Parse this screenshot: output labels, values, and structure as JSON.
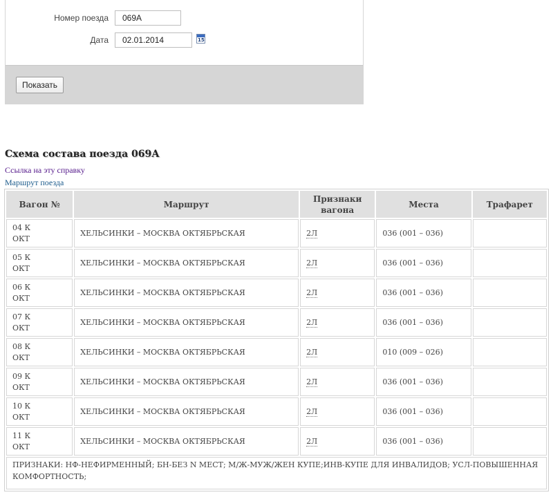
{
  "form": {
    "train_label": "Номер поезда",
    "train_value": "069А",
    "date_label": "Дата",
    "date_value": "02.01.2014",
    "calendar_digits": "15",
    "show_button": "Показать"
  },
  "schedule": {
    "title": "Схема состава поезда 069А",
    "link_reference": "Ссылка на эту справку",
    "link_route": "Маршрут поезда"
  },
  "table": {
    "headers": [
      "Вагон №",
      "Маршрут",
      "Признаки вагона",
      "Места",
      "Трафарет"
    ],
    "rows": [
      {
        "car": "04 К",
        "cat": "ОКТ",
        "route": "ХЕЛЬСИНКИ – МОСКВА ОКТЯБРЬСКАЯ",
        "sign": "2Л",
        "seats": "036 (001 – 036)",
        "stencil": ""
      },
      {
        "car": "05 К",
        "cat": "ОКТ",
        "route": "ХЕЛЬСИНКИ – МОСКВА ОКТЯБРЬСКАЯ",
        "sign": "2Л",
        "seats": "036 (001 – 036)",
        "stencil": ""
      },
      {
        "car": "06 К",
        "cat": "ОКТ",
        "route": "ХЕЛЬСИНКИ – МОСКВА ОКТЯБРЬСКАЯ",
        "sign": "2Л",
        "seats": "036 (001 – 036)",
        "stencil": ""
      },
      {
        "car": "07 К",
        "cat": "ОКТ",
        "route": "ХЕЛЬСИНКИ – МОСКВА ОКТЯБРЬСКАЯ",
        "sign": "2Л",
        "seats": "036 (001 – 036)",
        "stencil": ""
      },
      {
        "car": "08 К",
        "cat": "ОКТ",
        "route": "ХЕЛЬСИНКИ – МОСКВА ОКТЯБРЬСКАЯ",
        "sign": "2Л",
        "seats": "010 (009 – 026)",
        "stencil": ""
      },
      {
        "car": "09 К",
        "cat": "ОКТ",
        "route": "ХЕЛЬСИНКИ – МОСКВА ОКТЯБРЬСКАЯ",
        "sign": "2Л",
        "seats": "036 (001 – 036)",
        "stencil": ""
      },
      {
        "car": "10 К",
        "cat": "ОКТ",
        "route": "ХЕЛЬСИНКИ – МОСКВА ОКТЯБРЬСКАЯ",
        "sign": "2Л",
        "seats": "036 (001 – 036)",
        "stencil": ""
      },
      {
        "car": "11 К",
        "cat": "ОКТ",
        "route": "ХЕЛЬСИНКИ – МОСКВА ОКТЯБРЬСКАЯ",
        "sign": "2Л",
        "seats": "036 (001 – 036)",
        "stencil": ""
      }
    ],
    "footnote": "ПРИЗНАКИ: НФ-НЕФИРМЕННЫЙ; БН-БЕЗ N МЕСТ; М/Ж-МУЖ/ЖЕН КУПЕ;ИНВ-КУПЕ ДЛЯ ИНВАЛИДОВ; УСЛ-ПОВЫШЕННАЯ КОМФОРТНОСТЬ;"
  },
  "colors": {
    "header_bg": "#e0e0e0",
    "button_bar_bg": "#d6d6d6",
    "link_visited": "#551a8b",
    "link": "#1a5a8b"
  },
  "icons": {
    "calendar": "calendar-icon"
  }
}
